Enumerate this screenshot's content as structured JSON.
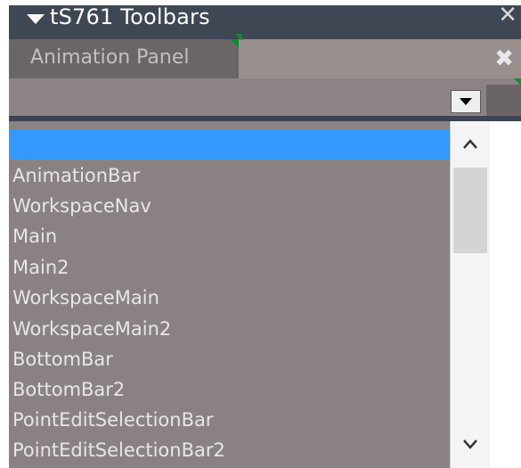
{
  "window": {
    "title": "tS761 Toolbars",
    "close_glyph": "✕"
  },
  "panel": {
    "tab_label": "Animation Panel",
    "close_glyph": "✖"
  },
  "combo": {
    "value": ""
  },
  "list": {
    "items": [
      "",
      "AnimationBar",
      "WorkspaceNav",
      "Main",
      "Main2",
      "WorkspaceMain",
      "WorkspaceMain2",
      "BottomBar",
      "BottomBar2",
      "PointEditSelectionBar",
      "PointEditSelectionBar2"
    ],
    "selected_index": 0
  },
  "scrollbar": {
    "up_icon": "chevron-up-icon",
    "down_icon": "chevron-down-icon"
  },
  "colors": {
    "title_bg": "#3f4654",
    "selected": "#3399ff",
    "list_bg": "#8a8282",
    "accent_notch": "#0e8c2f"
  }
}
